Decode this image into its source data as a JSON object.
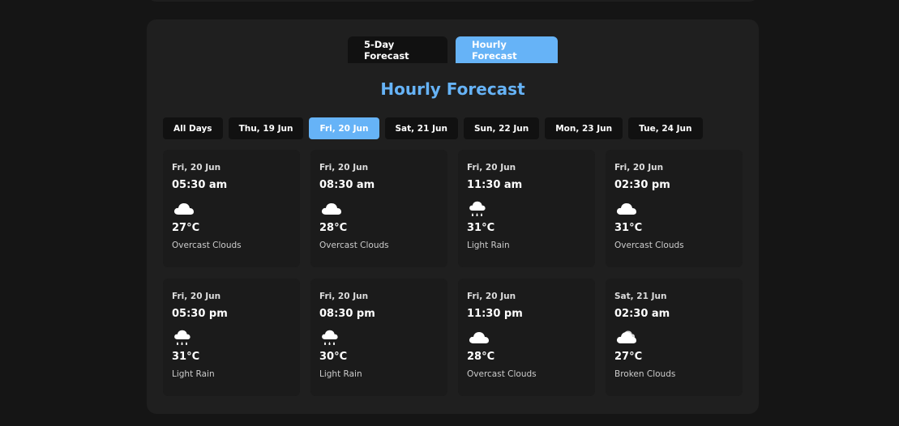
{
  "view_tabs": [
    {
      "label": "5-Day Forecast",
      "active": false
    },
    {
      "label": "Hourly Forecast",
      "active": true
    }
  ],
  "section_title": "Hourly Forecast",
  "day_filters": [
    {
      "label": "All Days",
      "active": false
    },
    {
      "label": "Thu, 19 Jun",
      "active": false
    },
    {
      "label": "Fri, 20 Jun",
      "active": true
    },
    {
      "label": "Sat, 21 Jun",
      "active": false
    },
    {
      "label": "Sun, 22 Jun",
      "active": false
    },
    {
      "label": "Mon, 23 Jun",
      "active": false
    },
    {
      "label": "Tue, 24 Jun",
      "active": false
    }
  ],
  "forecast": [
    {
      "date": "Fri, 20 Jun",
      "time": "05:30 am",
      "icon": "cloud-icon",
      "temp": "27°C",
      "desc": "Overcast Clouds"
    },
    {
      "date": "Fri, 20 Jun",
      "time": "08:30 am",
      "icon": "cloud-icon",
      "temp": "28°C",
      "desc": "Overcast Clouds"
    },
    {
      "date": "Fri, 20 Jun",
      "time": "11:30 am",
      "icon": "rain-cloud-icon",
      "temp": "31°C",
      "desc": "Light Rain"
    },
    {
      "date": "Fri, 20 Jun",
      "time": "02:30 pm",
      "icon": "cloud-icon",
      "temp": "31°C",
      "desc": "Overcast Clouds"
    },
    {
      "date": "Fri, 20 Jun",
      "time": "05:30 pm",
      "icon": "rain-cloud-icon",
      "temp": "31°C",
      "desc": "Light Rain"
    },
    {
      "date": "Fri, 20 Jun",
      "time": "08:30 pm",
      "icon": "rain-cloud-icon",
      "temp": "30°C",
      "desc": "Light Rain"
    },
    {
      "date": "Fri, 20 Jun",
      "time": "11:30 pm",
      "icon": "cloud-icon",
      "temp": "28°C",
      "desc": "Overcast Clouds"
    },
    {
      "date": "Sat, 21 Jun",
      "time": "02:30 am",
      "icon": "broken-clouds-icon",
      "temp": "27°C",
      "desc": "Broken Clouds"
    }
  ],
  "colors": {
    "accent": "#66b3f7",
    "background": "#151515",
    "panel": "#1f1f1f",
    "card": "#1b1b1b",
    "chip": "#111111"
  }
}
